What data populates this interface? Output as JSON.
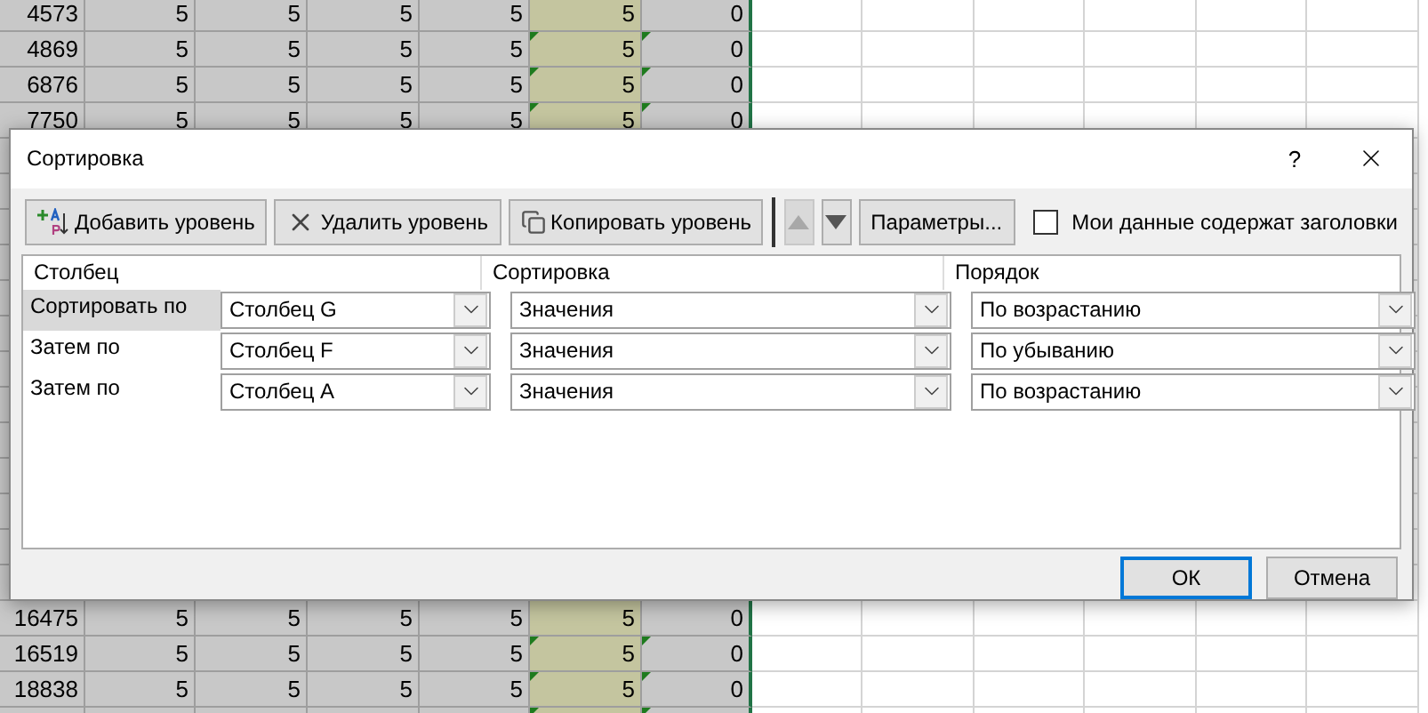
{
  "sheet": {
    "top_rows": [
      {
        "cells": [
          "4573",
          "5",
          "5",
          "5",
          "5",
          "5",
          "0"
        ],
        "flagged": false
      },
      {
        "cells": [
          "4869",
          "5",
          "5",
          "5",
          "5",
          "5",
          "0"
        ],
        "flagged": true
      },
      {
        "cells": [
          "6876",
          "5",
          "5",
          "5",
          "5",
          "5",
          "0"
        ],
        "flagged": true
      },
      {
        "cells": [
          "7750",
          "5",
          "5",
          "5",
          "5",
          "5",
          "0"
        ],
        "flagged": true
      }
    ],
    "bottom_rows": [
      {
        "cells": [
          "16475",
          "5",
          "5",
          "5",
          "5",
          "5",
          "0"
        ],
        "flagged": false
      },
      {
        "cells": [
          "16519",
          "5",
          "5",
          "5",
          "5",
          "5",
          "0"
        ],
        "flagged": true
      },
      {
        "cells": [
          "18838",
          "5",
          "5",
          "5",
          "5",
          "5",
          "0"
        ],
        "flagged": true
      },
      {
        "flagged": true
      }
    ]
  },
  "dialog": {
    "title": "Сортировка",
    "help": "?",
    "toolbar": [
      {
        "kind": "add",
        "label": "Добавить уровень"
      },
      {
        "kind": "delete",
        "label": "Удалить уровень"
      },
      {
        "kind": "copy",
        "label": "Копировать уровень"
      },
      {
        "kind": "up",
        "disabled": true
      },
      {
        "kind": "down",
        "disabled": false
      },
      {
        "kind": "text",
        "label": "Параметры..."
      }
    ],
    "headers_checkbox": {
      "label": "Мои данные содержат заголовки",
      "checked": false
    },
    "columns": [
      "Столбец",
      "Сортировка",
      "Порядок"
    ],
    "levels": [
      {
        "label": "Сортировать по",
        "column": "Столбец G",
        "sort_on": "Значения",
        "order": "По возрастанию",
        "selected": true
      },
      {
        "label": "Затем по",
        "column": "Столбец F",
        "sort_on": "Значения",
        "order": "По убыванию",
        "selected": false
      },
      {
        "label": "Затем по",
        "column": "Столбец A",
        "sort_on": "Значения",
        "order": "По возрастанию",
        "selected": false
      }
    ],
    "buttons": [
      {
        "label": "ОК",
        "default": true
      },
      {
        "label": "Отмена",
        "default": false
      }
    ]
  }
}
